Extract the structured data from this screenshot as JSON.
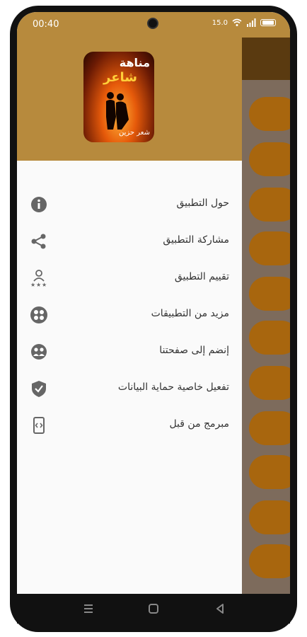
{
  "status_bar": {
    "time": "00:40",
    "network_speed": "15.0",
    "icons": [
      "wifi-icon",
      "signal-icon",
      "battery-icon"
    ]
  },
  "drawer": {
    "logo": {
      "title_line1": "مناهة",
      "title_line2": "شاعر",
      "footer": "شعر حزين"
    },
    "items": [
      {
        "label": "حول التطبيق",
        "icon": "info-icon"
      },
      {
        "label": "مشاركة التطبيق",
        "icon": "share-icon"
      },
      {
        "label": "تقييم التطبيق",
        "icon": "rate-icon"
      },
      {
        "label": "مزيد من التطبيقات",
        "icon": "more-apps-icon"
      },
      {
        "label": "إنضم إلى صفحتنا",
        "icon": "join-page-icon"
      },
      {
        "label": "تفعيل خاصية حماية البيانات",
        "icon": "shield-icon"
      },
      {
        "label": "مبرمج من قبل",
        "icon": "developer-icon"
      }
    ]
  },
  "colors": {
    "header_brown": "#b78a3d",
    "icon_gray": "#666666",
    "background_list_row": "#a8660e"
  },
  "nav_bar": [
    "recent-apps-icon",
    "home-icon",
    "back-icon"
  ]
}
